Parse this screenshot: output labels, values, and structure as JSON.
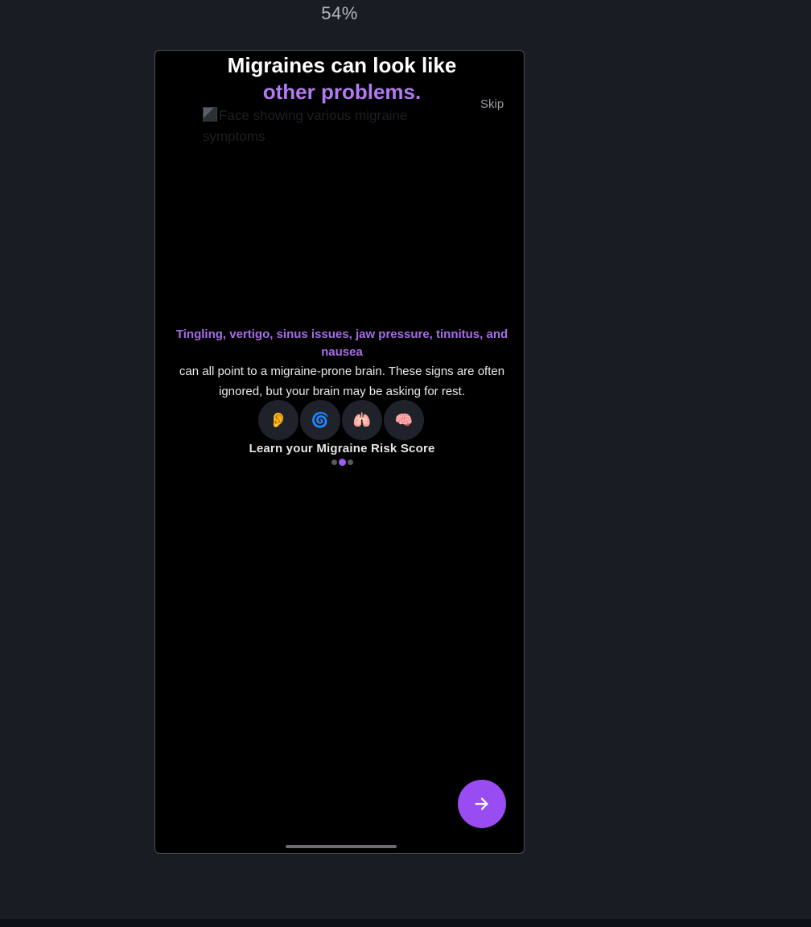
{
  "viewer": {
    "zoom_label": "54%"
  },
  "onboarding": {
    "headline_line1": "Migraines can look like",
    "headline_line2": "other problems.",
    "skip_label": "Skip",
    "hero_image_alt": "Face showing various migraine symptoms",
    "symptoms_highlight": "Tingling, vertigo, sinus issues, jaw pressure, tinnitus, and nausea",
    "body_text": "can all point to a migraine-prone brain. These signs are often ignored, but your brain may be asking for rest.",
    "symptom_icons": [
      {
        "name": "ear-icon",
        "glyph": "👂"
      },
      {
        "name": "spiral-icon",
        "glyph": "🌀"
      },
      {
        "name": "lungs-icon",
        "glyph": "🫁"
      },
      {
        "name": "brain-icon",
        "glyph": "🧠"
      }
    ],
    "cta_label": "Learn your Migraine Risk Score",
    "pagination": {
      "total": 3,
      "active_index": 1
    }
  },
  "colors": {
    "accent": "#9a4cf3",
    "highlight_text": "#a86de8",
    "background": "#000000",
    "page_background": "#1a1c23"
  }
}
